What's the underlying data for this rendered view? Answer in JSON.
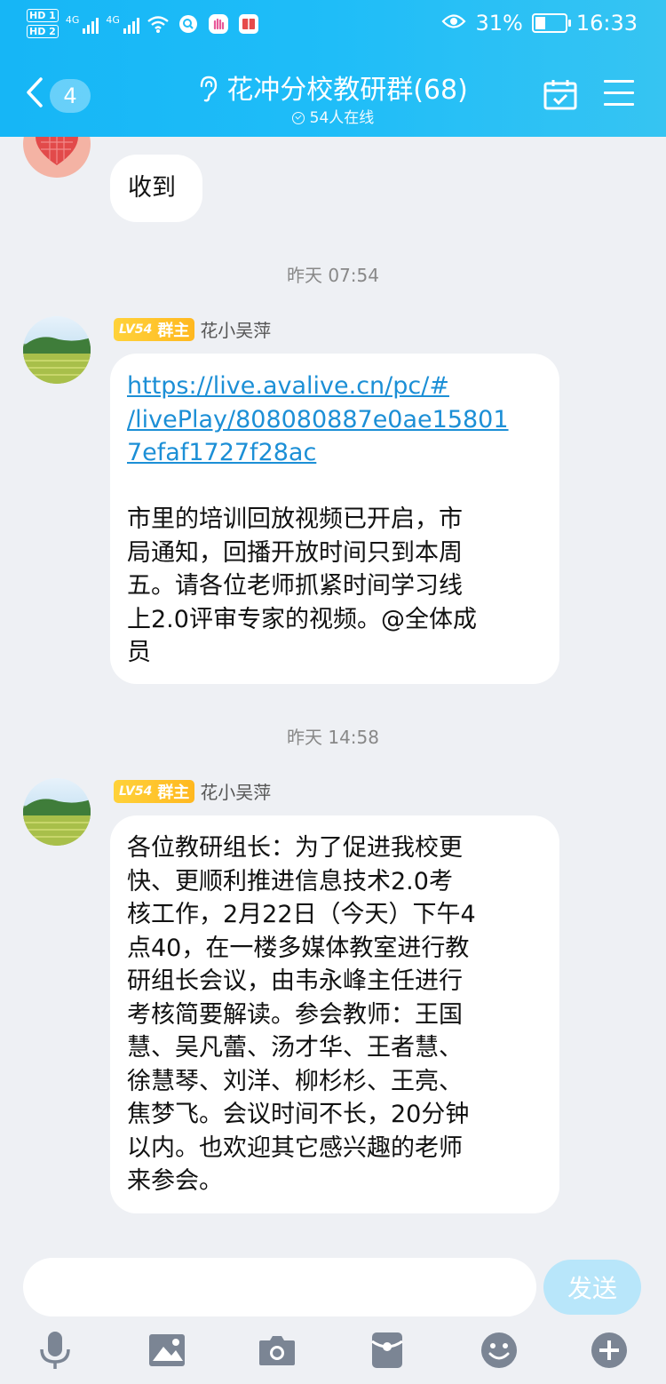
{
  "status_bar": {
    "hd1": "HD 1",
    "hd2": "HD 2",
    "net1": "4G",
    "net2": "4G",
    "battery": "31%",
    "time": "16:33"
  },
  "header": {
    "back_count": "4",
    "title": "花冲分校教研群(68)",
    "online": "54人在线"
  },
  "messages": [
    {
      "text": "收到"
    },
    {
      "time": "昨天 07:54",
      "badge_level": "LV54",
      "badge_role": "群主",
      "sender": "花小吴萍",
      "link_lines": [
        "https://live.avalive.cn/pc/#",
        "/livePlay/808080887e0ae15801",
        "7efaf1727f28ac"
      ],
      "body_lines": [
        "市里的培训回放视频已开启，市",
        "局通知，回播开放时间只到本周",
        "五。请各位老师抓紧时间学习线",
        "上2.0评审专家的视频。@全体成",
        "员"
      ]
    },
    {
      "time": "昨天 14:58",
      "badge_level": "LV54",
      "badge_role": "群主",
      "sender": "花小吴萍",
      "body_lines": [
        "各位教研组长：为了促进我校更",
        "快、更顺利推进信息技术2.0考",
        "核工作，2月22日（今天）下午4",
        "点40，在一楼多媒体教室进行教",
        "研组长会议，由韦永峰主任进行",
        "考核简要解读。参会教师：王国",
        "慧、吴凡蕾、汤才华、王者慧、",
        "徐慧琴、刘洋、柳杉杉、王亮、",
        "焦梦飞。会议时间不长，20分钟",
        "以内。也欢迎其它感兴趣的老师",
        "来参会。"
      ]
    }
  ],
  "input": {
    "placeholder": "",
    "send_label": "发送"
  },
  "toolbar": {
    "icons": [
      "microphone-icon",
      "image-icon",
      "camera-icon",
      "red-packet-icon",
      "emoji-icon",
      "plus-icon"
    ]
  },
  "colors": {
    "header": "#1fbdf8",
    "link": "#1c8fd6",
    "send_disabled": "#b8e6fa",
    "badge": "#ffc42a"
  }
}
